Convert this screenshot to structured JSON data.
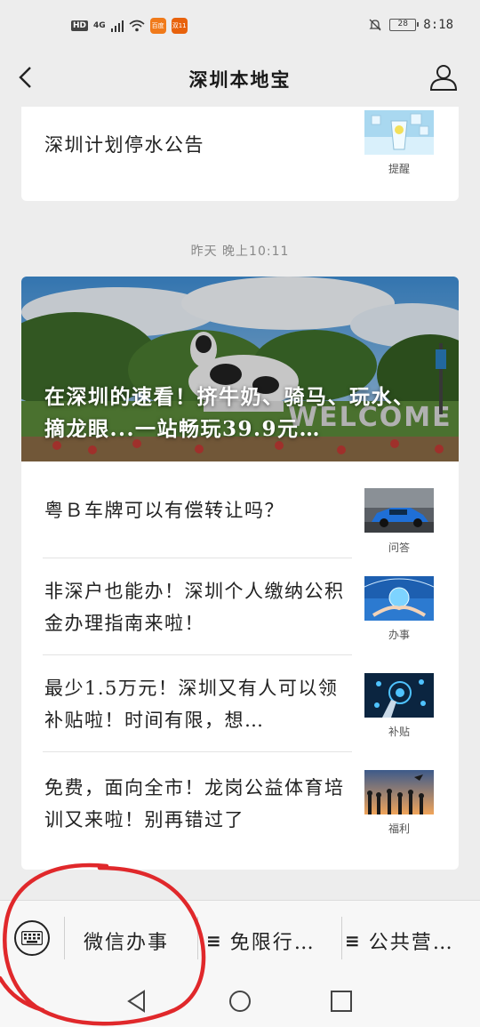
{
  "status_bar": {
    "hd": "HD",
    "network": "4G",
    "app1": "百度",
    "app2": "双11",
    "battery": "28",
    "time": "8:18"
  },
  "nav": {
    "title": "深圳本地宝"
  },
  "top_card": {
    "title": "深圳计划停水公告",
    "tag": "提醒"
  },
  "timestamp": "昨天 晚上10:11",
  "hero": {
    "title": "在深圳的速看！挤牛奶、骑马、玩水、摘龙眼...一站畅玩39.9元…"
  },
  "articles": [
    {
      "title": "粤Ｂ车牌可以有偿转让吗？",
      "tag": "问答",
      "icon": "car-thumbnail"
    },
    {
      "title": "非深户也能办！深圳个人缴纳公积金办理指南来啦！",
      "tag": "办事",
      "icon": "hand-globe-thumbnail"
    },
    {
      "title": "最少1.5万元！深圳又有人可以领补贴啦！时间有限，想…",
      "tag": "补贴",
      "icon": "touch-tech-thumbnail"
    },
    {
      "title": "免费，面向全市！龙岗公益体育培训又来啦！别再错过了",
      "tag": "福利",
      "icon": "sunset-people-thumbnail"
    }
  ],
  "menu": {
    "items": [
      {
        "label": "微信办事"
      },
      {
        "label": "免限行…"
      },
      {
        "label": "公共营…"
      }
    ]
  },
  "colors": {
    "background": "#ededed",
    "card": "#ffffff",
    "annotation": "#e0282b"
  }
}
